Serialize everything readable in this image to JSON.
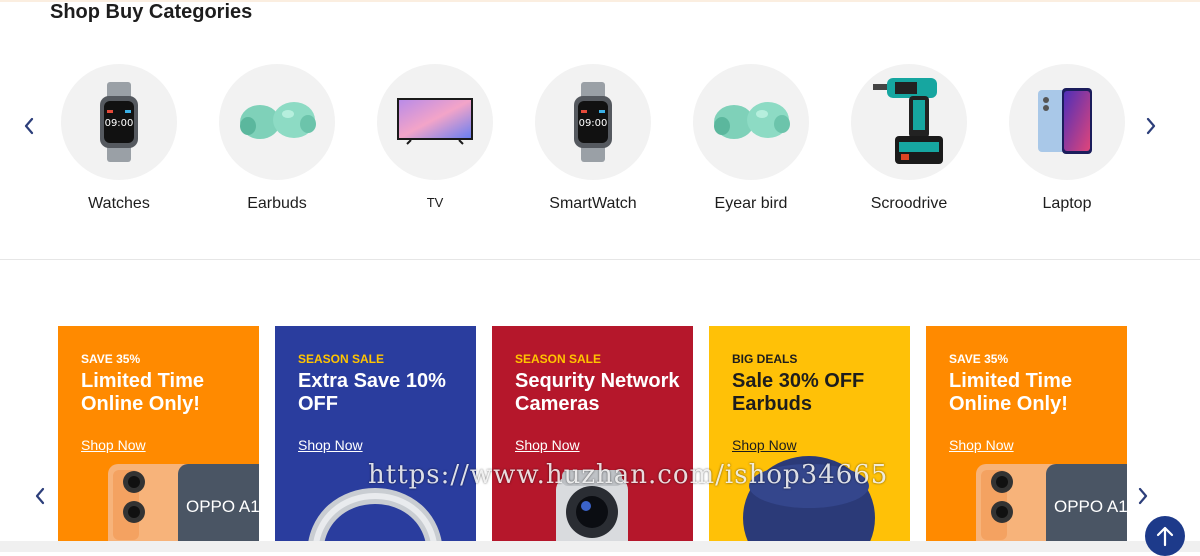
{
  "section": {
    "title": "Shop Buy Categories"
  },
  "categories": [
    {
      "label": "Watches",
      "icon": "smartwatch-icon"
    },
    {
      "label": "Earbuds",
      "icon": "earbuds-icon"
    },
    {
      "label": "TV",
      "icon": "tv-icon"
    },
    {
      "label": "SmartWatch",
      "icon": "smartwatch-icon"
    },
    {
      "label": "Eyear bird",
      "icon": "earbuds-icon"
    },
    {
      "label": "Scroodrive",
      "icon": "drill-icon"
    },
    {
      "label": "Laptop",
      "icon": "phone-icon"
    }
  ],
  "banners": [
    {
      "tag": "SAVE 35%",
      "headline": "Limited Time Online Only!",
      "cta": "Shop Now",
      "bg": "#ff8a00",
      "tag_color": "#ffffff",
      "text_color": "#ffffff",
      "art": "phone-image",
      "art_text": "OPPO A1"
    },
    {
      "tag": "SEASON SALE",
      "headline": "Extra Save 10% OFF",
      "cta": "Shop Now",
      "bg": "#2a3d9e",
      "tag_color": "#ffc400",
      "text_color": "#ffffff",
      "art": "headphones-image"
    },
    {
      "tag": "SEASON SALE",
      "headline": "Sequrity Network Cameras",
      "cta": "Shop Now",
      "bg": "#b5172b",
      "tag_color": "#ffc400",
      "text_color": "#ffffff",
      "art": "camera-image"
    },
    {
      "tag": "BIG DEALS",
      "headline": "Sale 30% OFF Earbuds",
      "cta": "Shop Now",
      "bg": "#ffc107",
      "tag_color": "#1d1d1d",
      "text_color": "#1d1d1d",
      "art": "earbuds-case-image"
    },
    {
      "tag": "SAVE 35%",
      "headline": "Limited Time Online Only!",
      "cta": "Shop Now",
      "bg": "#ff8a00",
      "tag_color": "#ffffff",
      "text_color": "#ffffff",
      "art": "phone-image",
      "art_text": "OPPO A1"
    }
  ],
  "watermark": "https://www.huzhan.com/ishop34665",
  "colors": {
    "accent": "#1d3a8a",
    "arrow": "#2c3e7a"
  }
}
